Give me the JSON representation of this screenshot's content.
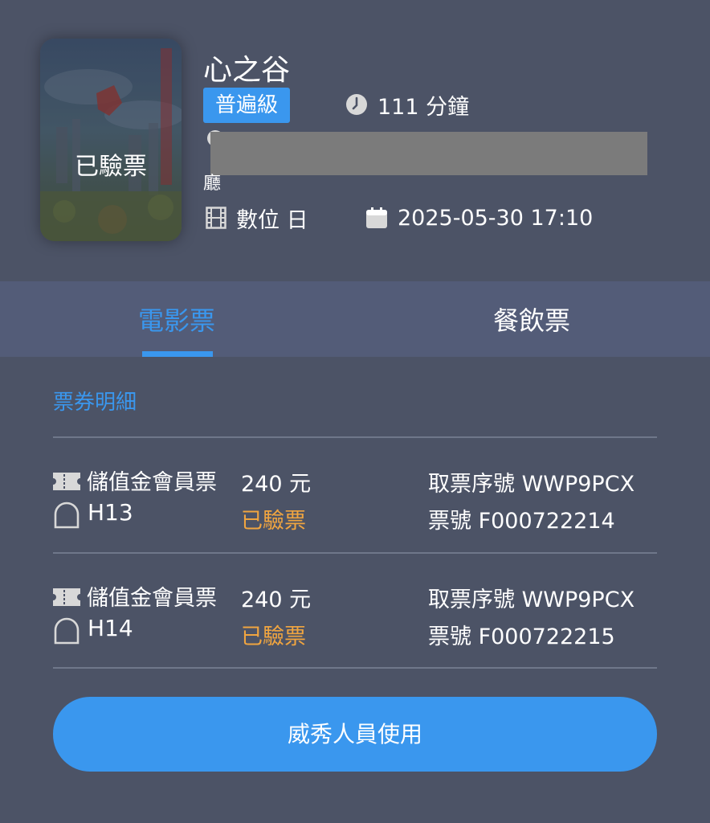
{
  "movie": {
    "title": "心之谷",
    "poster_status": "已驗票",
    "rating": "普遍級",
    "duration": "111 分鐘",
    "hall_suffix": "廳",
    "format": "數位 日",
    "datetime": "2025-05-30 17:10"
  },
  "tabs": [
    {
      "label": "電影票",
      "active": true
    },
    {
      "label": "餐飲票",
      "active": false
    }
  ],
  "details": {
    "section_title": "票券明細",
    "tickets": [
      {
        "type": "儲值金會員票",
        "price": "240 元",
        "pickup": "取票序號 WWP9PCX",
        "seat": "H13",
        "status": "已驗票",
        "number": "票號 F000722214"
      },
      {
        "type": "儲值金會員票",
        "price": "240 元",
        "pickup": "取票序號 WWP9PCX",
        "seat": "H14",
        "status": "已驗票",
        "number": "票號 F000722215"
      }
    ]
  },
  "staff_button": "威秀人員使用",
  "colors": {
    "background": "#4c5366",
    "tab_bar": "#535c78",
    "accent": "#3a97ee",
    "status": "#f0a540"
  },
  "icons": [
    "clock-icon",
    "location-icon",
    "film-icon",
    "calendar-icon",
    "ticket-icon",
    "seat-icon"
  ]
}
